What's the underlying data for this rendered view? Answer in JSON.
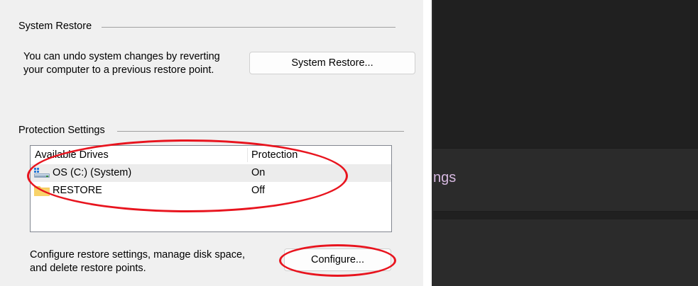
{
  "system_restore_group": {
    "title": "System Restore",
    "description_line1": "You can undo system changes by reverting",
    "description_line2": "your computer to a previous restore point.",
    "button_label": "System Restore..."
  },
  "protection_group": {
    "title": "Protection Settings",
    "columns": [
      "Available Drives",
      "Protection"
    ],
    "drives": [
      {
        "name": "OS (C:) (System)",
        "protection": "On",
        "icon": "system-drive-icon"
      },
      {
        "name": "RESTORE",
        "protection": "Off",
        "icon": "folder-icon"
      }
    ],
    "configure_description_line1": "Configure restore settings, manage disk space,",
    "configure_description_line2": "and delete restore points.",
    "configure_button_label": "Configure..."
  },
  "background_app": {
    "partial_text": "ngs"
  },
  "colors": {
    "annotation": "#e8141e",
    "dialog_bg": "#f0f0f0",
    "dark_bg": "#202020",
    "accent_text": "#d6b8e0"
  }
}
